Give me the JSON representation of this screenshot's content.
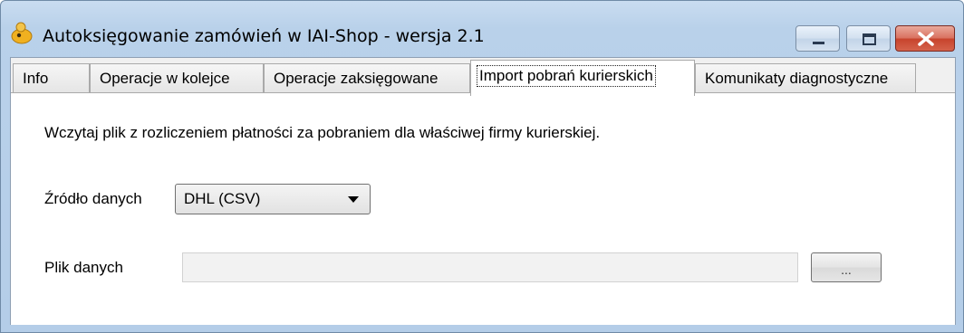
{
  "window": {
    "title": "Autoksięgowanie zamówień w IAI-Shop - wersja 2.1",
    "icon": "app-icon",
    "controls": {
      "minimize": "minimize-icon",
      "maximize": "maximize-icon",
      "close": "close-icon"
    }
  },
  "tabs": [
    {
      "label": "Info",
      "active": false
    },
    {
      "label": "Operacje w kolejce",
      "active": false
    },
    {
      "label": "Operacje zaksięgowane",
      "active": false
    },
    {
      "label": "Import pobrań kurierskich",
      "active": true
    },
    {
      "label": "Komunikaty diagnostyczne",
      "active": false
    }
  ],
  "panel": {
    "description": "Wczytaj plik z rozliczeniem płatności za pobraniem dla właściwej firmy kurierskiej.",
    "source_label": "Źródło danych",
    "source_value": "DHL (CSV)",
    "file_label": "Plik danych",
    "file_value": "",
    "browse_label": "..."
  },
  "colors": {
    "frame": "#b9d1ea",
    "close_button": "#c7432c",
    "panel_bg": "#ffffff"
  }
}
